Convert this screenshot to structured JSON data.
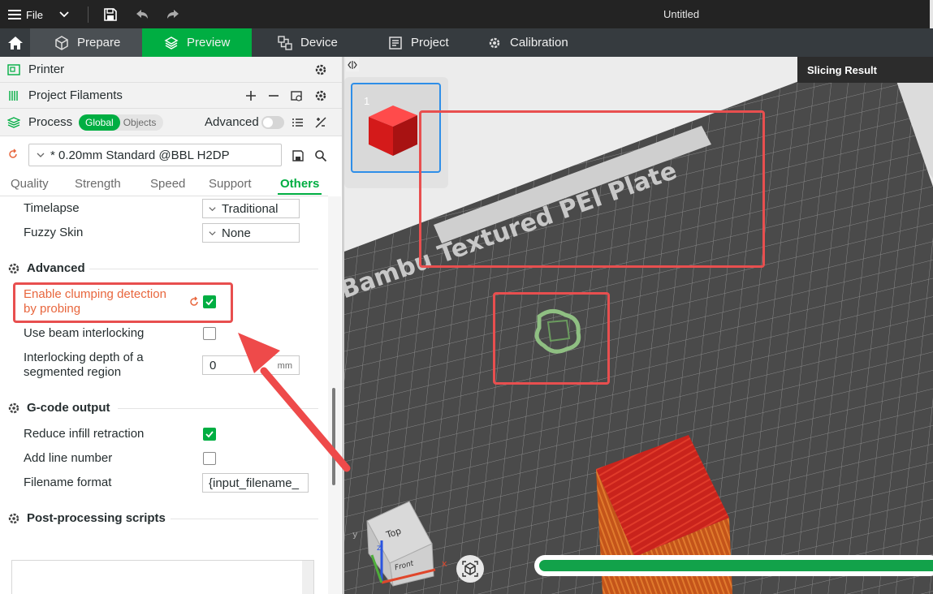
{
  "titlebar": {
    "file_label": "File",
    "title": "Untitled"
  },
  "nav": {
    "tabs": [
      {
        "label": "Prepare"
      },
      {
        "label": "Preview"
      },
      {
        "label": "Device"
      },
      {
        "label": "Project"
      },
      {
        "label": "Calibration"
      }
    ]
  },
  "sections": {
    "printer": "Printer",
    "filaments": "Project Filaments",
    "process": "Process",
    "global": "Global",
    "objects": "Objects",
    "advanced": "Advanced"
  },
  "preset": {
    "name": "* 0.20mm Standard @BBL H2DP"
  },
  "tabs": [
    "Quality",
    "Strength",
    "Speed",
    "Support",
    "Others"
  ],
  "options": {
    "timelapse": {
      "label": "Timelapse",
      "value": "Traditional"
    },
    "fuzzy_skin": {
      "label": "Fuzzy Skin",
      "value": "None"
    },
    "group_advanced": "Advanced",
    "clumping_line1": "Enable clumping detection",
    "clumping_line2": "by probing",
    "beam_interlocking": "Use beam interlocking",
    "interlock_depth_line1": "Interlocking depth of a",
    "interlock_depth_line2": "segmented region",
    "interlock_depth_value": "0",
    "interlock_depth_unit": "mm",
    "group_gcode": "G-code output",
    "reduce_infill": "Reduce infill retraction",
    "add_line_number": "Add line number",
    "filename_format": "Filename format",
    "filename_value": "{input_filename_",
    "group_post": "Post-processing scripts"
  },
  "viewport": {
    "plate_number": "1",
    "slicing_result": "Slicing Result",
    "plate_text": "Bambu Textured PEI Plate",
    "cube_top": "Top",
    "cube_front": "Front",
    "axis_x": "x",
    "axis_y": "y",
    "axis_z": "z"
  },
  "colors": {
    "accent": "#00ae42",
    "annotation": "#e84f4f",
    "warn_text": "#e8663d"
  }
}
